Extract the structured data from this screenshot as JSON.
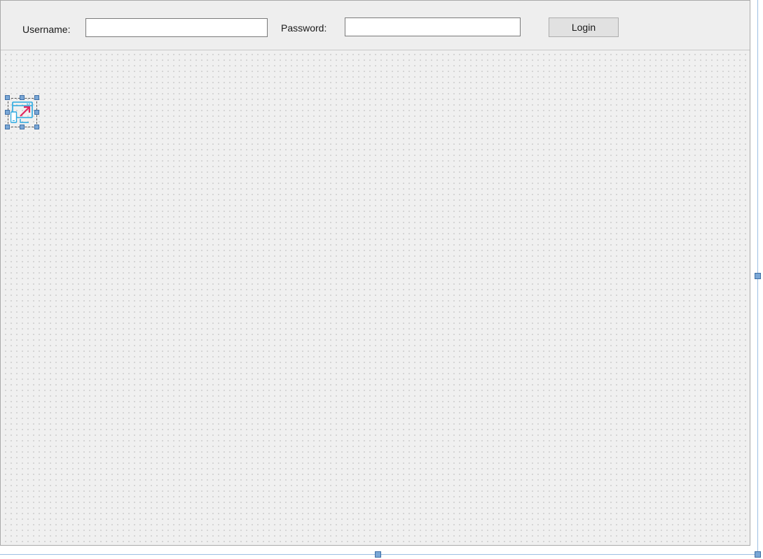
{
  "login_panel": {
    "username_label": "Username:",
    "username_value": "",
    "password_label": "Password:",
    "password_value": "",
    "login_button": "Login"
  },
  "component_tray": {
    "selected_component_icon": "web-browser-component-icon"
  },
  "colors": {
    "surface": "#f0f0f0",
    "selection_handle": "#7aa7d6",
    "icon_blue": "#29a8e0",
    "icon_arrow": "#e0245e"
  }
}
